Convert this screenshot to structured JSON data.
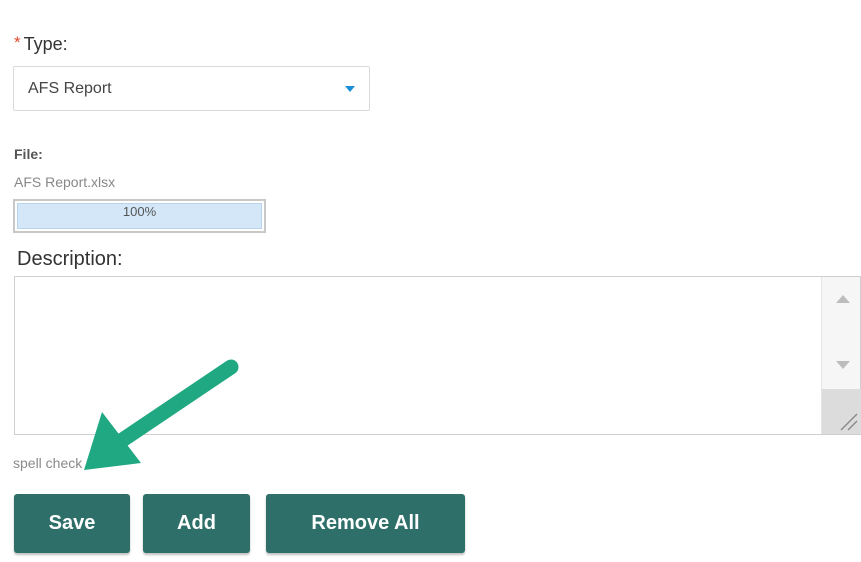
{
  "form": {
    "type_label": "Type:",
    "required_marker": "*",
    "type_value": "AFS Report",
    "file_label": "File:",
    "file_name": "AFS Report.xlsx",
    "upload_progress": "100%",
    "upload_progress_fraction": 1.0,
    "description_label": "Description:",
    "description_value": "",
    "spellcheck_text": "spell check"
  },
  "buttons": {
    "save": "Save",
    "add": "Add",
    "remove_all": "Remove All"
  },
  "colors": {
    "button_bg": "#2e6f69",
    "arrow": "#1fa882",
    "required": "#e04b2f",
    "dropdown_caret": "#1a8fd6",
    "progress_fill": "#d3e7f8"
  },
  "icons": {
    "dropdown": "chevron-down-icon",
    "scroll_up": "scroll-up-icon",
    "scroll_down": "scroll-down-icon",
    "resize": "resize-grip-icon",
    "annotation": "arrow-pointer-icon"
  }
}
